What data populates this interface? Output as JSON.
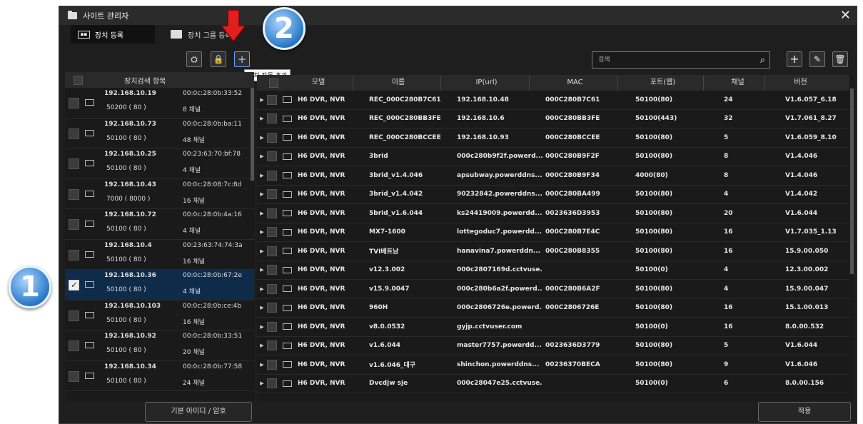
{
  "window": {
    "title": "사이트 관리자"
  },
  "tabs": [
    {
      "label": "장치 등록"
    },
    {
      "label": "장치 그룹 등록"
    }
  ],
  "toolbar": {
    "tooltip": "장치 자동 추가"
  },
  "search": {
    "placeholder": "검색"
  },
  "left_panel": {
    "header": "장치검색 항목",
    "rows": [
      {
        "ip": "192.168.10.19",
        "mac": "00:0c:28:0b:33:52",
        "port": "50200 ( 80 )",
        "ch": "8 채널"
      },
      {
        "ip": "192.168.10.73",
        "mac": "00:0c:28:0b:ba:11",
        "port": "50100 ( 80 )",
        "ch": "48 채널"
      },
      {
        "ip": "192.168.10.25",
        "mac": "00:23:63:70:bf:78",
        "port": "50100 ( 80 )",
        "ch": "4 채널"
      },
      {
        "ip": "192.168.10.43",
        "mac": "00:0c:28:08:7c:8d",
        "port": "7000 ( 8000 )",
        "ch": "16 채널"
      },
      {
        "ip": "192.168.10.72",
        "mac": "00:0c:28:0b:4a:16",
        "port": "50100 ( 80 )",
        "ch": "4 채널"
      },
      {
        "ip": "192.168.10.4",
        "mac": "00:23:63:74:74:3a",
        "port": "50100 ( 80 )",
        "ch": "16 채널"
      },
      {
        "ip": "192.168.10.36",
        "mac": "00:0c:28:0b:67:2e",
        "port": "50100 ( 80 )",
        "ch": "4 채널"
      },
      {
        "ip": "192.168.10.103",
        "mac": "00:0c:28:0b:ce:4b",
        "port": "50100 ( 80 )",
        "ch": "16 채널"
      },
      {
        "ip": "192.168.10.92",
        "mac": "00:0c:28:0b:33:51",
        "port": "50100 ( 80 )",
        "ch": "20 채널"
      },
      {
        "ip": "192.168.10.34",
        "mac": "00:0c:28:0b:77:58",
        "port": "50100 ( 80 )",
        "ch": "24 채널"
      }
    ],
    "selected_index": 6,
    "button": "기본 아이디 / 암호"
  },
  "grid": {
    "headers": {
      "model": "모델",
      "name": "이름",
      "ip": "IP(url)",
      "mac": "MAC",
      "port": "포트(웹)",
      "ch": "채널",
      "ver": "버전"
    },
    "rows": [
      {
        "model": "H6 DVR, NVR",
        "name": "REC_000C280B7C61",
        "ip": "192.168.10.48",
        "mac": "000C280B7C61",
        "port": "50100(80)",
        "ch": "24",
        "ver": "V1.6.057_6.18"
      },
      {
        "model": "H6 DVR, NVR",
        "name": "REC_000C280BB3FE",
        "ip": "192.168.10.6",
        "mac": "000C280BB3FE",
        "port": "50100(443)",
        "ch": "32",
        "ver": "V1.7.061_8.27"
      },
      {
        "model": "H6 DVR, NVR",
        "name": "REC_000C280BCCEE",
        "ip": "192.168.10.93",
        "mac": "000C280BCCEE",
        "port": "50100(80)",
        "ch": "5",
        "ver": "V1.6.059_8.10"
      },
      {
        "model": "H6 DVR, NVR",
        "name": "3brid",
        "ip": "000c280b9f2f.powerd...",
        "mac": "000C280B9F2F",
        "port": "50100(80)",
        "ch": "8",
        "ver": "V1.4.046"
      },
      {
        "model": "H6 DVR, NVR",
        "name": "3brid_v1.4.046",
        "ip": "apsubway.powerddns...",
        "mac": "000C280B9F34",
        "port": "4000(80)",
        "ch": "8",
        "ver": "V1.4.046"
      },
      {
        "model": "H6 DVR, NVR",
        "name": "3brid_v1.4.042",
        "ip": "90232842.powerddns...",
        "mac": "000C280BA499",
        "port": "50100(80)",
        "ch": "4",
        "ver": "V1.4.042"
      },
      {
        "model": "H6 DVR, NVR",
        "name": "5brid_v1.6.044",
        "ip": "ks24419009.powerdd...",
        "mac": "0023636D3953",
        "port": "50100(80)",
        "ch": "20",
        "ver": "V1.6.044"
      },
      {
        "model": "H6 DVR, NVR",
        "name": "MX7-1600",
        "ip": "lottegoduc7.powerdd...",
        "mac": "000C280B7E4C",
        "port": "50100(80)",
        "ch": "16",
        "ver": "V1.7.035_1.13"
      },
      {
        "model": "H6 DVR, NVR",
        "name": "TVI베트남",
        "ip": "hanavina7.powerddn...",
        "mac": "000C280B8355",
        "port": "50100(80)",
        "ch": "16",
        "ver": "15.9.00.050"
      },
      {
        "model": "H6 DVR, NVR",
        "name": "v12.3.002",
        "ip": "000c2807169d.cctvuse...",
        "mac": "",
        "port": "50100(0)",
        "ch": "4",
        "ver": "12.3.00.002"
      },
      {
        "model": "H6 DVR, NVR",
        "name": "v15.9.0047",
        "ip": "000c280b6a2f.powerd...",
        "mac": "000C280B6A2F",
        "port": "50100(80)",
        "ch": "4",
        "ver": "15.9.00.047"
      },
      {
        "model": "H6 DVR, NVR",
        "name": "960H",
        "ip": "000c2806726e.powerd...",
        "mac": "000C2806726E",
        "port": "50100(80)",
        "ch": "16",
        "ver": "15.1.00.013"
      },
      {
        "model": "H6 DVR, NVR",
        "name": "v8.0.0532",
        "ip": "gyjp.cctvuser.com",
        "mac": "",
        "port": "50100(0)",
        "ch": "16",
        "ver": "8.0.00.532"
      },
      {
        "model": "H6 DVR, NVR",
        "name": "v1.6.044",
        "ip": "master7757.powerdd...",
        "mac": "0023636D3779",
        "port": "50100(80)",
        "ch": "5",
        "ver": "V1.6.044"
      },
      {
        "model": "H6 DVR, NVR",
        "name": "v1.6.046_대구",
        "ip": "shinchon.powerddns...",
        "mac": "00236370BECA",
        "port": "50100(80)",
        "ch": "9",
        "ver": "V1.6.046"
      },
      {
        "model": "H6 DVR, NVR",
        "name": "Dvcdjw sje",
        "ip": "000c28047e25.cctvuse...",
        "mac": "",
        "port": "50100(0)",
        "ch": "6",
        "ver": "8.0.00.156"
      }
    ],
    "apply_button": "적용"
  },
  "badges": {
    "one": "1",
    "two": "2"
  },
  "colors": {
    "selected_row": "#0f2b4a",
    "badge_blue": "#2a78c8",
    "arrow_red": "#e02020"
  }
}
